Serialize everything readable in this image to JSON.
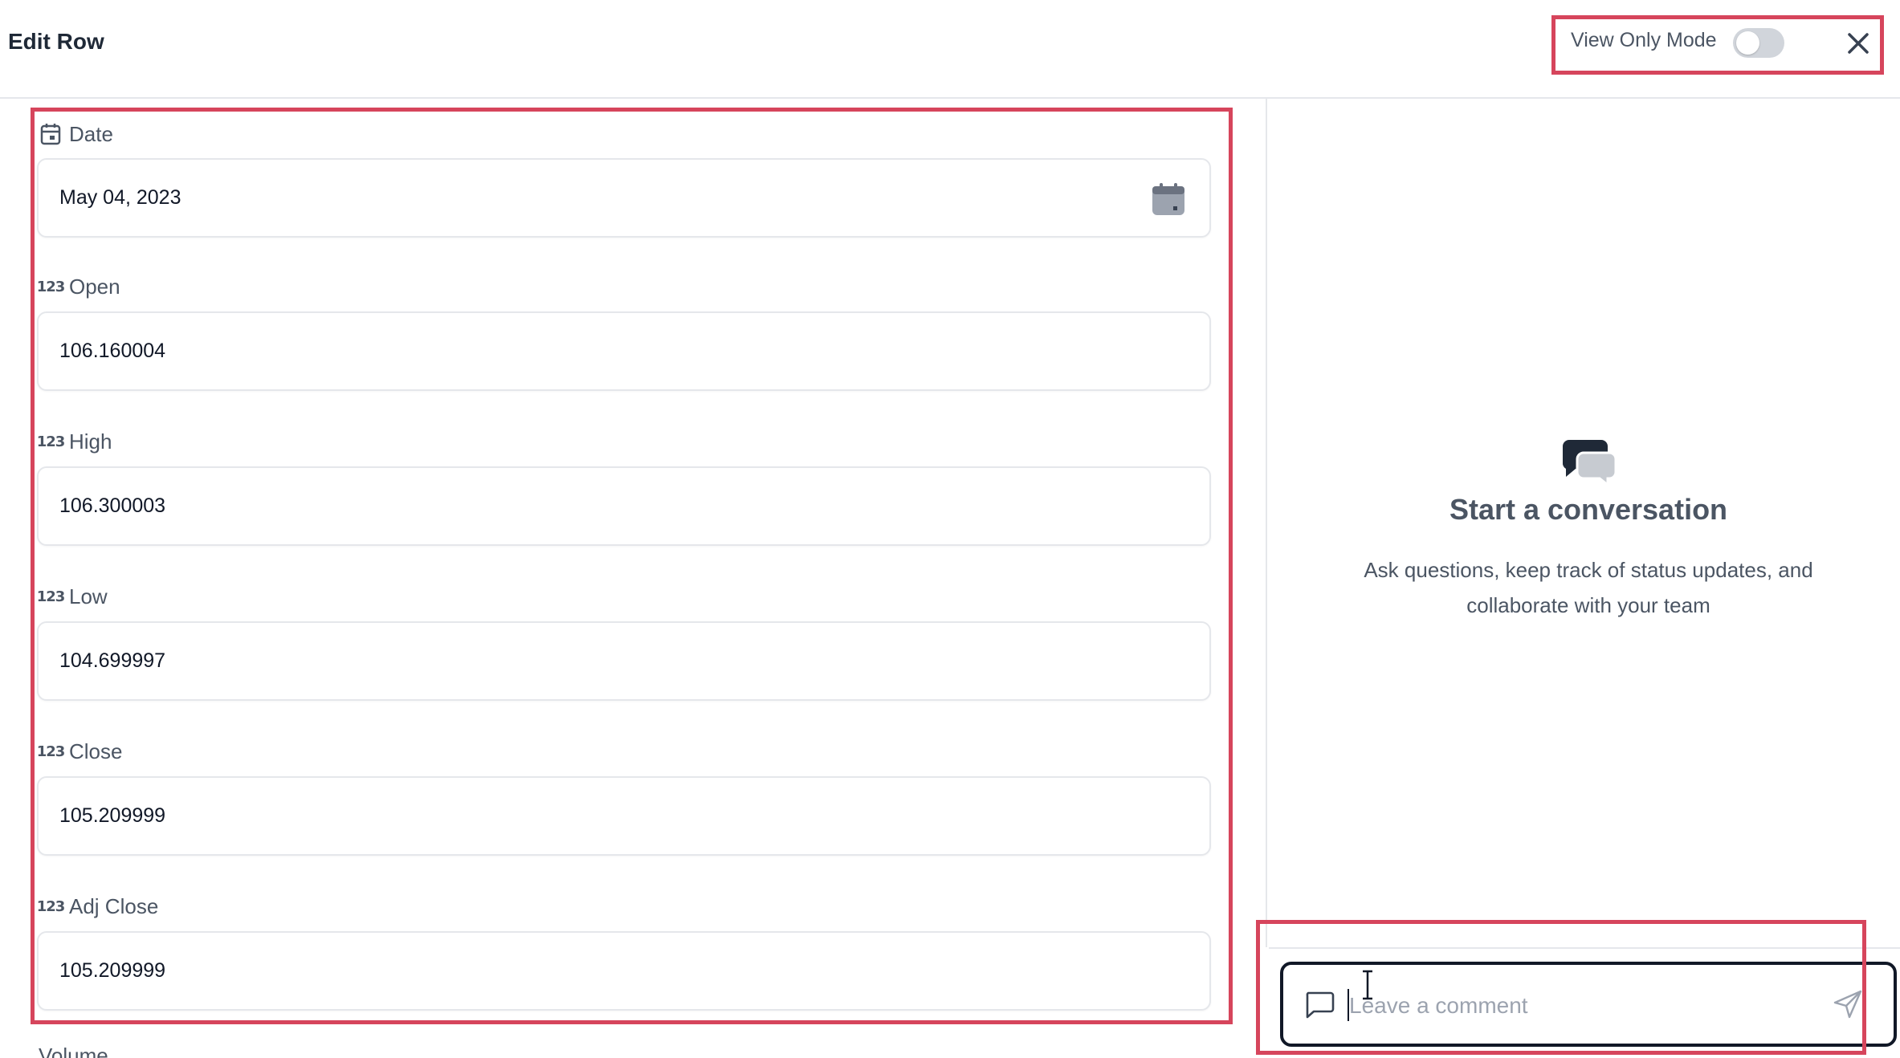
{
  "header": {
    "title": "Edit Row",
    "view_only_label": "View Only Mode",
    "view_only_enabled": false,
    "close_icon": "close-icon"
  },
  "fields": [
    {
      "label": "Date",
      "type_icon": "calendar-icon",
      "value": "May 04, 2023",
      "picker_icon": "calendar-icon"
    },
    {
      "label": "Open",
      "type_icon": "number-icon",
      "type_icon_text": "123",
      "value": "106.160004"
    },
    {
      "label": "High",
      "type_icon": "number-icon",
      "type_icon_text": "123",
      "value": "106.300003"
    },
    {
      "label": "Low",
      "type_icon": "number-icon",
      "type_icon_text": "123",
      "value": "104.699997"
    },
    {
      "label": "Close",
      "type_icon": "number-icon",
      "type_icon_text": "123",
      "value": "105.209999"
    },
    {
      "label": "Adj Close",
      "type_icon": "number-icon",
      "type_icon_text": "123",
      "value": "105.209999"
    }
  ],
  "next_field_partial": "Volume",
  "conversation": {
    "icon": "chat-bubbles-icon",
    "title": "Start a conversation",
    "subtitle": "Ask questions, keep track of status updates, and collaborate with your team"
  },
  "comment": {
    "placeholder": "Leave a comment",
    "value": "",
    "icon": "comment-icon",
    "send_icon": "send-icon"
  },
  "colors": {
    "highlight": "#d6455c",
    "text_primary": "#1f2937",
    "text_secondary": "#4b5563",
    "border": "#e5e7eb"
  }
}
